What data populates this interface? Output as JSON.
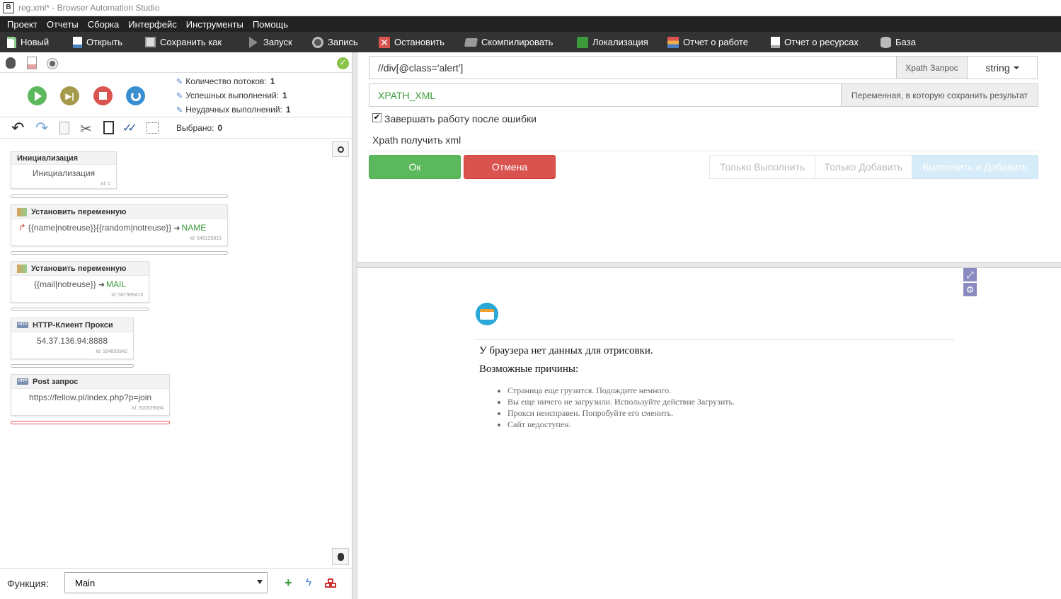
{
  "window": {
    "title": "reg.xml* - Browser Automation Studio",
    "app_icon": "B"
  },
  "menu": [
    "Проект",
    "Отчеты",
    "Сборка",
    "Интерфейс",
    "Инструменты",
    "Помощь"
  ],
  "toolbar": {
    "new": "Новый",
    "open": "Открыть",
    "save_as": "Сохранить как",
    "run": "Запуск",
    "record": "Запись",
    "stop": "Остановить",
    "compile": "Скомпилировать",
    "localization": "Локализация",
    "work_report": "Отчет о работе",
    "resource_report": "Отчет о ресурсах",
    "database": "База"
  },
  "stats": {
    "threads_label": "Количество потоков:",
    "threads_value": "1",
    "success_label": "Успешных выполнений:",
    "success_value": "1",
    "fail_label": "Неудачных выполнений:",
    "fail_value": "1"
  },
  "selection": {
    "label": "Выбрано:",
    "value": "0"
  },
  "blocks": [
    {
      "title": "Инициализация",
      "body": "Инициализация",
      "id": "Id: 0"
    },
    {
      "title": "Установить переменную",
      "body": "{{name|notreuse}}{{random|notreuse}}",
      "var": "NAME",
      "id": "Id: 549125819"
    },
    {
      "title": "Установить переменную",
      "body": "{{mail|notreuse}}",
      "var": "MAIL",
      "id": "Id: 587389473"
    },
    {
      "title": "HTTP-Клиент Прокси",
      "body": "54.37.136.94:8888",
      "id": "Id: 164855842"
    },
    {
      "title": "Post запрос",
      "body": "https://fellow.pl/index.php?p=join",
      "id": "Id: 500529694"
    }
  ],
  "function": {
    "label": "Функция:",
    "value": "Main"
  },
  "editor": {
    "xpath_value": "//div[@class='alert']",
    "xpath_addon": "Xpath Запрос",
    "type_value": "string",
    "var_value": "XPATH_XML",
    "var_addon": "Переменная, в которую сохранить результат",
    "checkbox_label": "Завершать работу после ошибки",
    "action_title": "Xpath получить xml",
    "ok": "Ок",
    "cancel": "Отмена",
    "only_run": "Только Выполнить",
    "only_add": "Только Добавить",
    "run_and_add": "Выполнить и Добавить"
  },
  "browser": {
    "no_data": "У браузера нет данных для отрисовки.",
    "reasons_title": "Возможные причины:",
    "reasons": [
      "Страница еще грузится. Подождите немного.",
      "Вы еще ничего не загрузили. Используйте действие Загрузить.",
      "Прокси неисправен. Попробуйте его сменить.",
      "Сайт недоступен."
    ]
  },
  "colors": {
    "ok": "#5cb85c",
    "cancel": "#d9534f",
    "menu_bg": "#222222",
    "toolbar_bg": "#333333",
    "var_green": "#3c9a3c"
  }
}
